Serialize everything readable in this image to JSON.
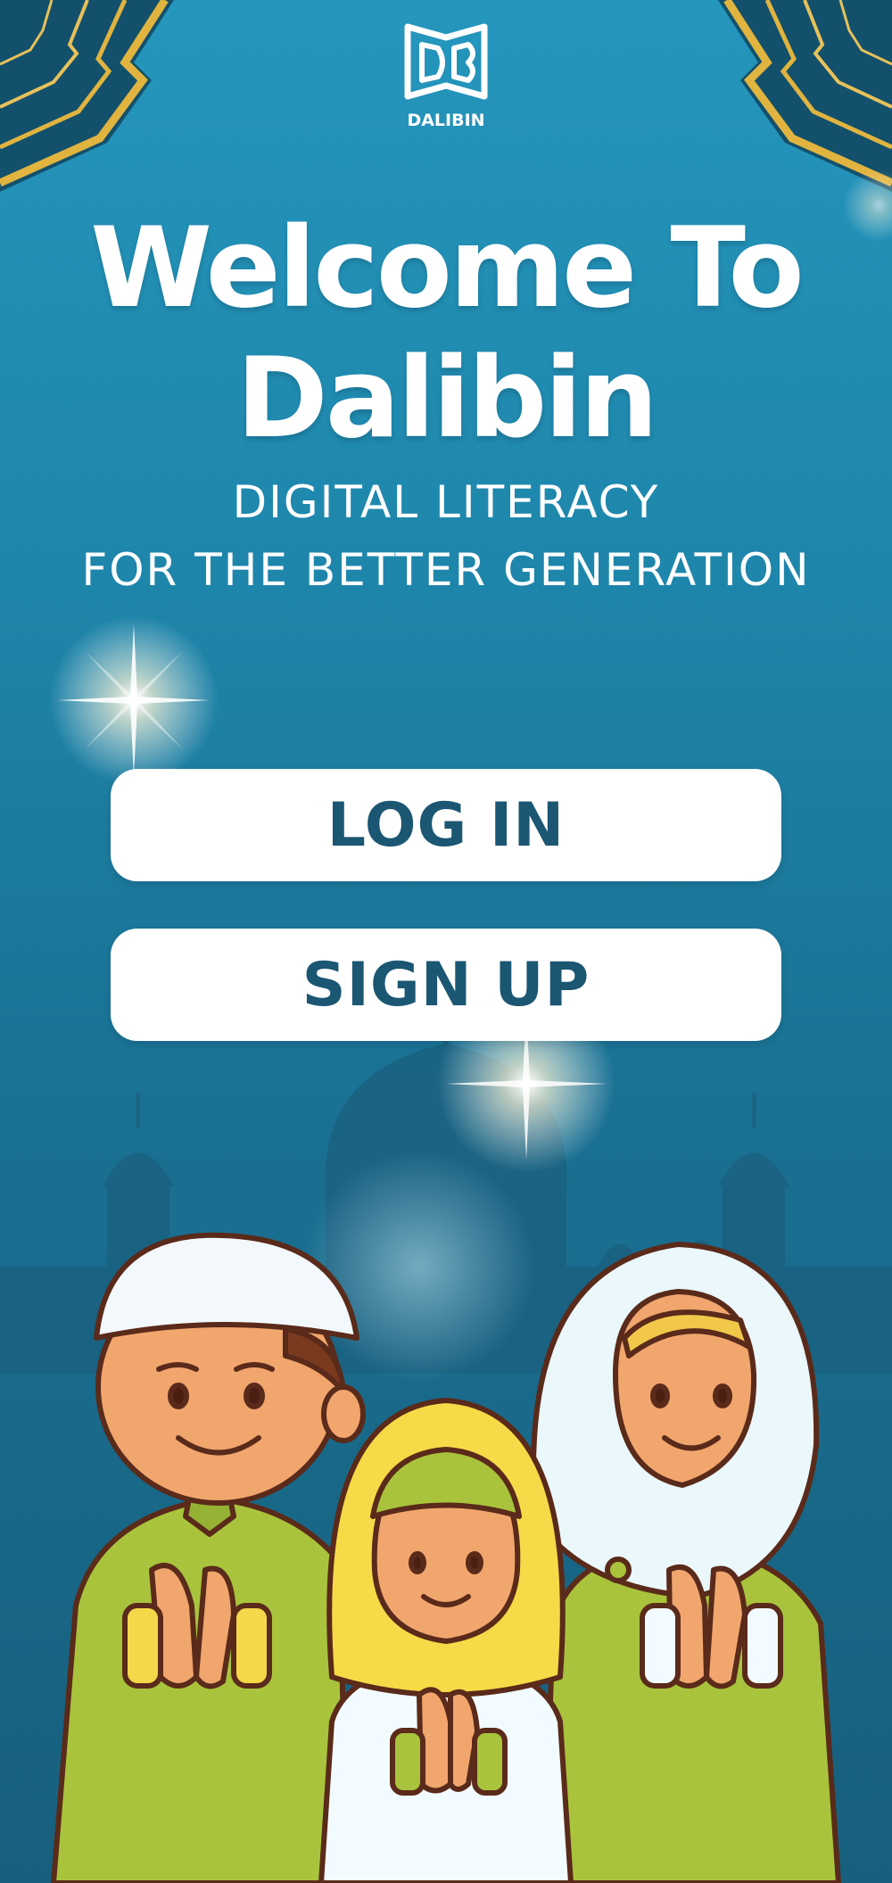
{
  "brand": {
    "logo_text": "DALIBIN",
    "logo_icon": "book-logo-icon"
  },
  "welcome": {
    "line1": "Welcome To",
    "line2": "Dalibin"
  },
  "tagline": {
    "line1": "DIGITAL LITERACY",
    "line2": "FOR THE BETTER GENERATION"
  },
  "actions": {
    "login_label": "LOG IN",
    "signup_label": "SIGN UP"
  },
  "illustrations": [
    "mosque-silhouette",
    "sparkle-glow",
    "gold-corner-ornament",
    "family-praying-illustration"
  ],
  "colors": {
    "background": "#1e86ab",
    "button_bg": "#ffffff",
    "button_text": "#1b5672",
    "gold": "#e0b43f"
  }
}
